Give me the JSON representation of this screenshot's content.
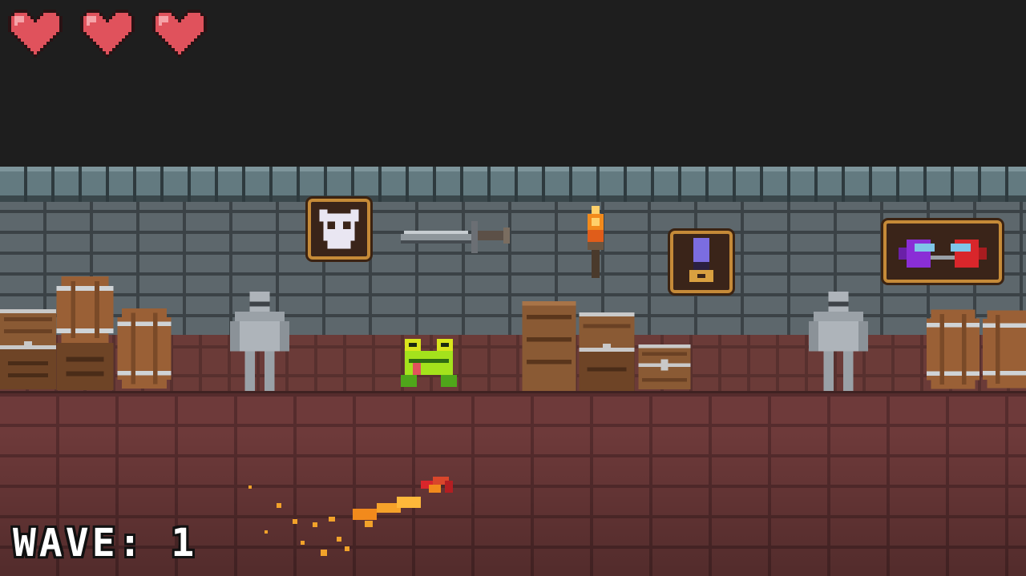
{
  "hud": {
    "lives": 3,
    "heart_icon": "heart-icon",
    "wave_label": "WAVE: 1"
  },
  "colors": {
    "heart": "#e0525c",
    "player": "#a4e21c",
    "fire": "#f28a1c",
    "wall": "#5d676c",
    "floor": "#6b3b38",
    "gold_frame": "#c58a38"
  },
  "wall_items": [
    "skull-emblem-icon",
    "sword-icon",
    "torch-icon",
    "potion-frame-icon",
    "crewmates-painting-icon"
  ],
  "props": [
    "treasure-chest-icon",
    "barrel-icon",
    "knight-armor-statue-icon",
    "bookshelf-icon"
  ],
  "player": {
    "sprite": "frog-icon"
  },
  "effect": "fire-trail"
}
